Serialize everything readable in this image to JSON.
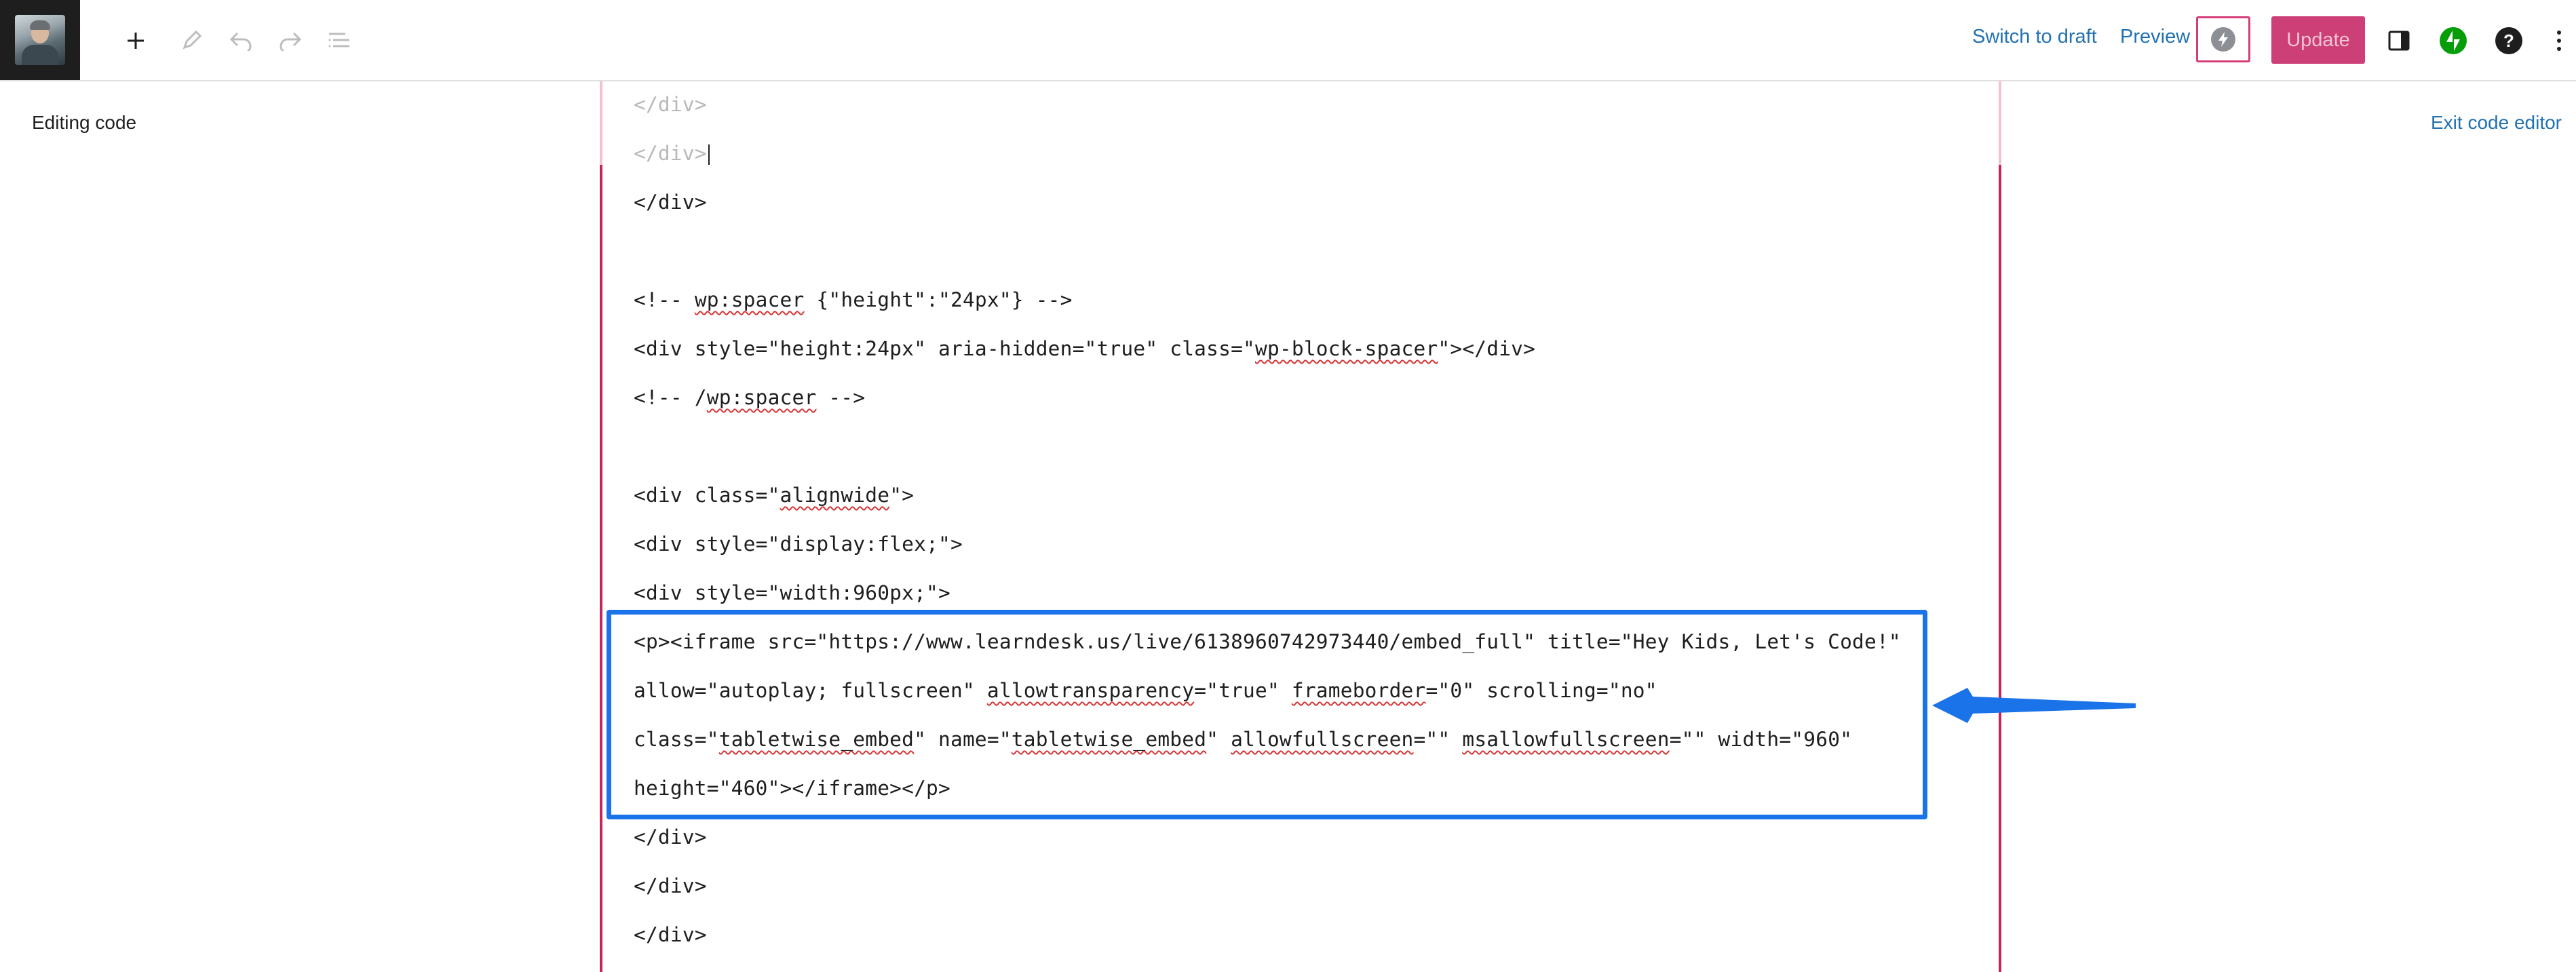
{
  "toolbar": {
    "switch_to_draft": "Switch to draft",
    "preview": "Preview",
    "update": "Update",
    "icons": [
      "add-block-icon",
      "edit-pen-icon",
      "undo-icon",
      "redo-icon",
      "document-overview-icon",
      "jetpack-bolt-icon",
      "settings-sidebar-icon",
      "jetpack-icon",
      "help-icon",
      "options-kebab-icon"
    ]
  },
  "editor": {
    "mode_label": "Editing code",
    "exit_label": "Exit code editor"
  },
  "code": {
    "l1": "</div>",
    "l2": "</div>",
    "l3": "</div>",
    "l4a": "<!-- ",
    "l4b": "wp:spacer",
    "l4c": " {\"height\":\"24px\"} -->",
    "l5a": "<div style=\"height:24px\" aria-hidden=\"true\" class=\"",
    "l5b": "wp-block-spacer",
    "l5c": "\"></div>",
    "l6a": "<!-- /",
    "l6b": "wp:spacer",
    "l6c": " -->",
    "l7a": "<div class=\"",
    "l7b": "alignwide",
    "l7c": "\">",
    "l8": "<div style=\"display:flex;\">",
    "l9": "<div style=\"width:960px;\">",
    "l10": "<p><iframe src=\"https://www.learndesk.us/live/6138960742973440/embed_full\" title=\"Hey Kids, Let's Code!\"",
    "l11a": "allow=\"autoplay; fullscreen\" ",
    "l11b": "allowtransparency",
    "l11c": "=\"true\" ",
    "l11d": "frameborder",
    "l11e": "=\"0\" scrolling=\"no\"",
    "l12a": "class=\"",
    "l12b": "tabletwise_embed",
    "l12c": "\" name=\"",
    "l12d": "tabletwise_embed",
    "l12e": "\" ",
    "l12f": "allowfullscreen",
    "l12g": "=\"\" ",
    "l12h": "msallowfullscreen",
    "l12i": "=\"\" width=\"960\"",
    "l13": "height=\"460\"></iframe></p>",
    "l14": "</div>",
    "l15": "</div>",
    "l16": "</div>"
  },
  "colors": {
    "link": "#2271b1",
    "update_bg": "#cd3f77",
    "block_border": "#c5245f",
    "highlight": "#1a73e8",
    "jetpack": "#069e08"
  }
}
